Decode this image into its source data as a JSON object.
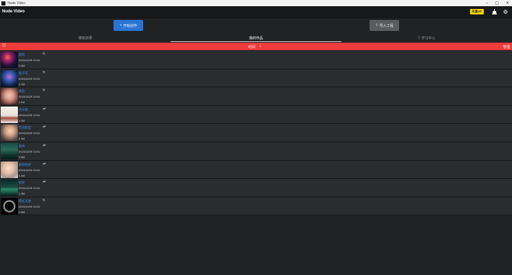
{
  "window": {
    "title": "Node Video",
    "controls": [
      "–",
      "▢",
      "✕"
    ]
  },
  "header": {
    "app_title": "Node Video",
    "vip_label": "开通VIP",
    "icons": [
      "broom-icon",
      "settings-icon"
    ]
  },
  "actions": {
    "start_create": {
      "icon": "+",
      "label": "开始创作"
    },
    "import_project": {
      "icon": "⇩",
      "label": "导入工程"
    }
  },
  "tabs": [
    {
      "label": "模板效果",
      "active": false,
      "icon": ""
    },
    {
      "label": "我的作品",
      "active": true,
      "icon": ""
    },
    {
      "label": "学习中心",
      "active": false,
      "icon": "▯"
    }
  ],
  "sortbar": {
    "label": "时间",
    "arrow": "⇣",
    "manage": "管理"
  },
  "projects": [
    {
      "name": "烟花",
      "date": "2024/10/29 13:01",
      "size": "0.9M",
      "action": "⇱",
      "thumb": "fireworks"
    },
    {
      "name": "粒子花",
      "date": "2024/10/29 13:01",
      "size": "1.7M",
      "action": "⇱",
      "thumb": "particles"
    },
    {
      "name": "换脸",
      "date": "2024/10/29 13:01",
      "size": "1.1M",
      "action": "⇱",
      "thumb": "face"
    },
    {
      "name": "大长腿",
      "date": "2024/10/29 13:01",
      "size": "1.3M",
      "action": "⇄",
      "thumb": "legs"
    },
    {
      "name": "塑造脸型",
      "date": "2024/10/29 13:01",
      "size": "0.4M",
      "action": "⇄",
      "thumb": "portrait"
    },
    {
      "name": "森林",
      "date": "2024/10/29 13:01",
      "size": "1.8M",
      "action": "⇄",
      "thumb": "forest"
    },
    {
      "name": "故障效果",
      "date": "2024/10/29 13:01",
      "size": "0.4M",
      "action": "⇄",
      "thumb": "glitch"
    },
    {
      "name": "星星",
      "date": "2024/10/29 13:01",
      "size": "1.3M",
      "action": "⇄",
      "thumb": "stars"
    },
    {
      "name": "霓虹光圈",
      "date": "2024/10/29 13:01",
      "size": "0.9M",
      "action": "⇱",
      "thumb": "ring"
    }
  ],
  "colors": {
    "accent": "#2a74d4",
    "sortbar": "#ef3b3b",
    "vip": "#f6d300",
    "link": "#3d8ee8"
  }
}
